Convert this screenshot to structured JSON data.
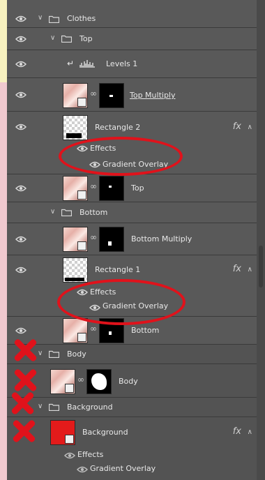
{
  "layers": {
    "clothes": "Clothes",
    "top": "Top",
    "levels": "Levels 1",
    "top_multiply": "Top Multiply",
    "rect2": "Rectangle 2",
    "rect2_effects": "Effects",
    "rect2_gradient": "Gradient Overlay",
    "top_layer": "Top",
    "bottom_group": "Bottom",
    "bottom_multiply": "Bottom Multiply",
    "rect1": "Rectangle 1",
    "rect1_effects": "Effects",
    "rect1_gradient": "Gradient Overlay",
    "bottom_layer": "Bottom",
    "body_group": "Body",
    "body_layer": "Body",
    "background_group": "Background",
    "background_layer": "Background",
    "bg_effects": "Effects",
    "bg_gradient": "Gradient Overlay"
  },
  "fx_symbol": "fx",
  "colors": {
    "panel": "#535353",
    "annotation_red": "#e0121b",
    "swatch_red": "#e31b1b",
    "strip_yellow": "#f7f1bf",
    "strip_pink": "#f0c9cf"
  },
  "icons": [
    "eye-icon",
    "folder-icon",
    "chevron-down-icon",
    "chain-link-icon",
    "levels-histogram-icon",
    "clip-arrow-icon",
    "fx-icon"
  ]
}
